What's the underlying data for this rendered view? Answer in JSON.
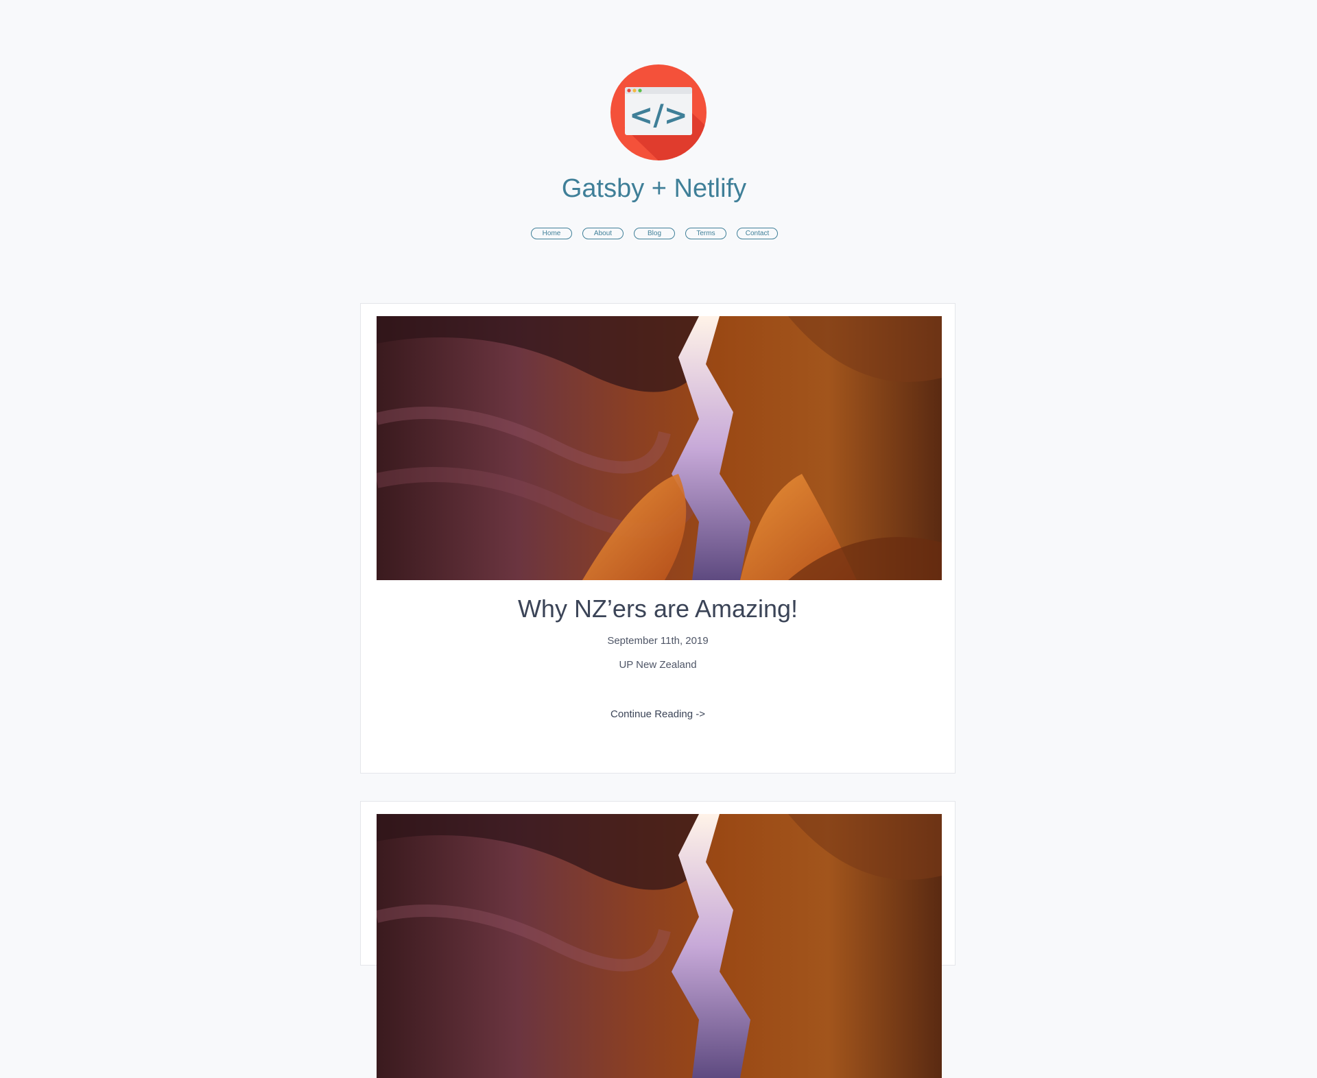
{
  "site": {
    "title": "Gatsby + Netlify",
    "logo_icon": "code-browser-icon",
    "accent_color": "#3f7f98"
  },
  "nav": {
    "items": [
      {
        "label": "Home"
      },
      {
        "label": "About"
      },
      {
        "label": "Blog"
      },
      {
        "label": "Terms"
      },
      {
        "label": "Contact"
      }
    ]
  },
  "posts": [
    {
      "title": "Why NZ’ers are Amazing!",
      "date": "September 11th, 2019",
      "category": "UP New Zealand",
      "read_more": "Continue Reading ->"
    }
  ]
}
